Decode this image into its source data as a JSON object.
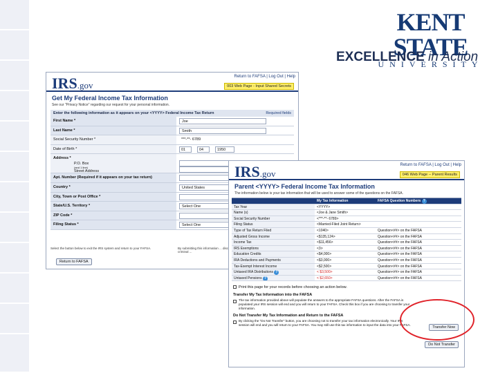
{
  "branding": {
    "logo_main": "KENT STATE",
    "logo_sub": "UNIVERSITY",
    "tagline_bold": "EXCELLENCE",
    "tagline_italic": "in Action"
  },
  "screen1": {
    "irs_logo": "IRS",
    "irs_domain": ".gov",
    "top_links": "Return to FAFSA | Log Out | Help",
    "page_note": "003 Web Page - Input Shared Secrets",
    "title": "Get My Federal Income Tax Information",
    "privacy_line": "See our \"Privacy Notice\" regarding our request for your personal information.",
    "instruction": "Enter the following information as it appears on your <YYYY> Federal Income Tax Return",
    "help_link": "Required fields",
    "fields": {
      "first_name_label": "First Name *",
      "first_name_value": "Joe",
      "last_name_label": "Last Name *",
      "last_name_value": "Smith",
      "ssn_label": "Social Security Number *",
      "ssn_value": "***-**- 6789",
      "dob_label": "Date of Birth *",
      "dob_month": "01",
      "dob_day": "04",
      "dob_year": "1950",
      "address_label": "Address *",
      "po_box_label": "P.O. Box",
      "po_box_hint": "(and 1 line)",
      "street_label": "Street Address",
      "apt_label": "Apt. Number (Required if it appears on your tax return)",
      "country_label": "Country *",
      "country_value": "United States",
      "city_label": "City, Town or Post Office *",
      "state_label": "State/U.S. Territory *",
      "state_value": "Select One",
      "zip_label": "ZIP Code *",
      "filing_label": "Filing Status *",
      "filing_value": "Select One"
    },
    "footer_left": "Select the button below to exit the IRS system and return to your FAFSA.",
    "footer_right": "By submitting this information ... disclosed. Use of this system may result in civil and criminal ...",
    "return_button": "Return to FAFSA"
  },
  "screen2": {
    "irs_logo": "IRS",
    "irs_domain": ".gov",
    "top_links": "Return to FAFSA | Log Out | Help",
    "page_note": "046 Web Page -- Parent Results",
    "title": "Parent <YYYY> Federal Income Tax Information",
    "subtitle": "The information below is your tax information that will be used to answer some of the questions on the FAFSA.",
    "table_headers": [
      "",
      "My Tax Information",
      "FAFSA Question Numbers"
    ],
    "rows": [
      {
        "label": "Tax Year",
        "value": "<YYYY>",
        "question": ""
      },
      {
        "label": "Name (s)",
        "value": "<Joe & Jane Smith>",
        "question": ""
      },
      {
        "label": "Social Security Number",
        "value": "<***-**- 6789>",
        "question": ""
      },
      {
        "label": "Filing Status",
        "value": "<Married-Filed Joint Return>",
        "question": ""
      },
      {
        "label": "Type of Tax Return Filed",
        "value": "<1040>",
        "question": "Question<##> on the FAFSA"
      },
      {
        "label": "Adjusted Gross Income",
        "value": "<$135,124>",
        "question": "Question<##> on the FAFSA"
      },
      {
        "label": "Income Tax",
        "value": "<$11,456>",
        "question": "Question<##> on the FAFSA"
      },
      {
        "label": "IRS Exemptions",
        "value": "<3>",
        "question": "Question<##> on the FAFSA"
      },
      {
        "label": "Education Credits",
        "value": "<$4,000>",
        "question": "Question<##> on the FAFSA"
      },
      {
        "label": "IRA Deductions and Payments",
        "value": "<$3,000>",
        "question": "Question<##> on the FAFSA"
      },
      {
        "label": "Tax-Exempt Interest Income",
        "value": "<$2,500>",
        "question": "Question<##> on the FAFSA"
      },
      {
        "label": "Untaxed IRA Distributions",
        "value": "< $3,500>",
        "question": "Question<##> on the FAFSA"
      },
      {
        "label": "Untaxed Pensions",
        "value": "< $2,650>",
        "question": "Question<##> on the FAFSA"
      }
    ],
    "print_line": "Print this page for your records before choosing an action below.",
    "transfer_heading": "Transfer My Tax Information into the FAFSA",
    "transfer_text": "The tax information provided above will populate the answers to the appropriate FAFSA questions. After the FAFSA is populated your IRS session will end and you will return to your FAFSA. Check this box if you are choosing to transfer your information.",
    "transfer_button": "Transfer Now",
    "no_transfer_heading": "Do Not Transfer My Tax Information and Return to the FAFSA",
    "no_transfer_text": "By clicking the \"Do Not Transfer\" button, you are choosing not to transfer your tax information electronically. Your IRS session will end and you will return to your FAFSA. You may still use this tax information to input the data into your FAFSA.",
    "no_transfer_button": "Do Not Transfer"
  },
  "colors": {
    "brand_navy": "#1d3c7a",
    "highlight_circle": "#e0232a",
    "note_yellow": "#ffef6a"
  }
}
